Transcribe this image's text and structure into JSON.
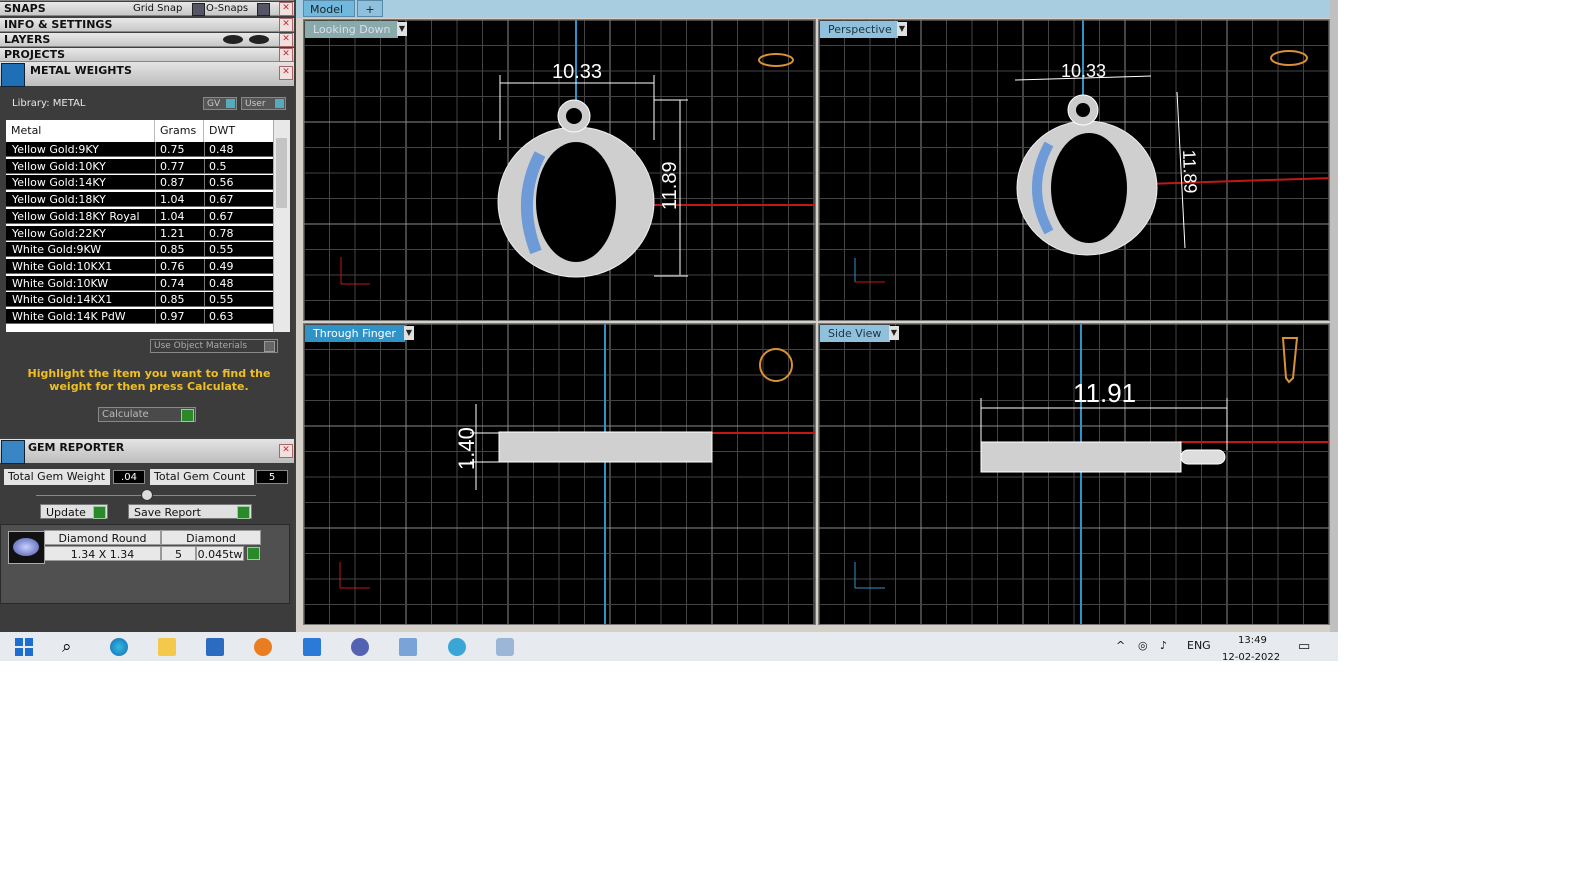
{
  "left_panel": {
    "snaps": {
      "title": "SNAPS",
      "grid_snap": "Grid Snap",
      "o_snaps": "O-Snaps"
    },
    "info_title": "INFO & SETTINGS",
    "layers_title": "LAYERS",
    "projects_title": "PROJECTS"
  },
  "metal_weights": {
    "title": "METAL WEIGHTS",
    "library": "Library: METAL",
    "gv_label": "GV",
    "user_label": "User",
    "columns": [
      "Metal",
      "Grams",
      "DWT"
    ],
    "rows": [
      {
        "metal": "Yellow Gold:9KY",
        "grams": "0.75",
        "dwt": "0.48"
      },
      {
        "metal": "Yellow Gold:10KY",
        "grams": "0.77",
        "dwt": "0.5"
      },
      {
        "metal": "Yellow Gold:14KY",
        "grams": "0.87",
        "dwt": "0.56"
      },
      {
        "metal": "Yellow Gold:18KY",
        "grams": "1.04",
        "dwt": "0.67"
      },
      {
        "metal": "Yellow Gold:18KY Royal",
        "grams": "1.04",
        "dwt": "0.67"
      },
      {
        "metal": "Yellow Gold:22KY",
        "grams": "1.21",
        "dwt": "0.78"
      },
      {
        "metal": "White Gold:9KW",
        "grams": "0.85",
        "dwt": "0.55"
      },
      {
        "metal": "White Gold:10KX1",
        "grams": "0.76",
        "dwt": "0.49"
      },
      {
        "metal": "White Gold:10KW",
        "grams": "0.74",
        "dwt": "0.48"
      },
      {
        "metal": "White Gold:14KX1",
        "grams": "0.85",
        "dwt": "0.55"
      },
      {
        "metal": "White Gold:14K PdW",
        "grams": "0.97",
        "dwt": "0.63"
      }
    ],
    "use_object_materials": "Use Object Materials",
    "hint": "Highlight the item you want to find the weight for then press Calculate.",
    "calculate_label": "Calculate"
  },
  "gem_reporter": {
    "title": "GEM REPORTER",
    "total_weight_label": "Total Gem Weight",
    "total_weight_value": ".04",
    "total_count_label": "Total Gem Count",
    "total_count_value": "5",
    "update_label": "Update",
    "save_label": "Save Report",
    "gem": {
      "shape": "Diamond Round",
      "size": "1.34 X 1.34",
      "material": "Diamond",
      "count": "5",
      "weight": "0.045tw"
    }
  },
  "tabs": [
    "Model",
    "+"
  ],
  "viewports": {
    "top_left": {
      "label": "Looking Down",
      "dim_h": "10.33",
      "dim_v": "11.89"
    },
    "top_right": {
      "label": "Perspective",
      "dim_h": "10.33",
      "dim_v": "11.89"
    },
    "bottom_left": {
      "label": "Through Finger",
      "dim_v": "1.40"
    },
    "bottom_right": {
      "label": "Side View",
      "dim_h": "11.91"
    }
  },
  "taskbar": {
    "lang": "ENG",
    "time": "13:49",
    "date": "12-02-2022"
  },
  "colors": {
    "accent_blue": "#2f93c8",
    "axis_red": "#c01818",
    "highlight": "#f0c020"
  }
}
